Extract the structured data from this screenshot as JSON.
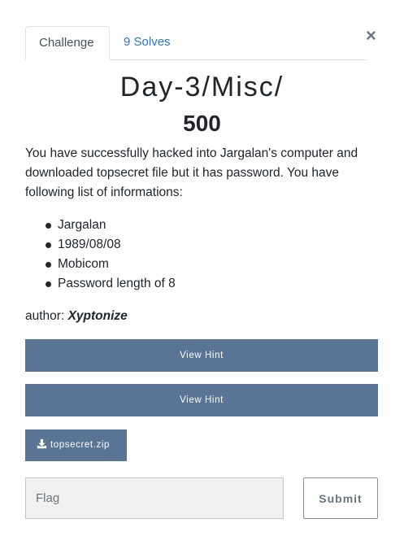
{
  "modal": {
    "close_label": "×",
    "tabs": [
      {
        "label": "Challenge"
      },
      {
        "label": "9 Solves"
      }
    ],
    "name": "Day-3/Misc/",
    "value": "500",
    "description": "You have successfully hacked into Jargalan's computer and downloaded topsecret file but it has password. You have following list of informations:",
    "list": [
      "Jargalan",
      "1989/08/08",
      "Mobicom",
      "Password length of 8"
    ],
    "author_prefix": "author:",
    "author_name": "Xyptonize",
    "hints": [
      {
        "label": "View Hint"
      },
      {
        "label": "View Hint"
      }
    ],
    "file": {
      "label": "topsecret.zip",
      "icon": "download-icon"
    },
    "flag_input": {
      "placeholder": "Flag",
      "value": ""
    },
    "submit_label": "Submit"
  },
  "colors": {
    "button": "#5a7496",
    "link": "#2c73c9"
  }
}
